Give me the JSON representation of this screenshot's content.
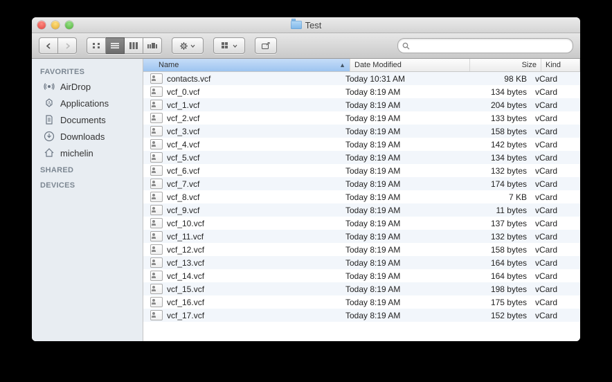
{
  "window": {
    "title": "Test"
  },
  "toolbar": {
    "search_placeholder": ""
  },
  "sidebar": {
    "sections": [
      {
        "title": "FAVORITES",
        "items": [
          {
            "id": "airdrop",
            "label": "AirDrop",
            "icon": "airdrop-icon"
          },
          {
            "id": "applications",
            "label": "Applications",
            "icon": "applications-icon"
          },
          {
            "id": "documents",
            "label": "Documents",
            "icon": "documents-icon"
          },
          {
            "id": "downloads",
            "label": "Downloads",
            "icon": "downloads-icon"
          },
          {
            "id": "michelin",
            "label": "michelin",
            "icon": "home-icon"
          }
        ]
      },
      {
        "title": "SHARED",
        "items": []
      },
      {
        "title": "DEVICES",
        "items": []
      }
    ]
  },
  "columns": {
    "name": "Name",
    "date": "Date Modified",
    "size": "Size",
    "kind": "Kind",
    "sort_column": "name",
    "sort_dir": "asc"
  },
  "files": [
    {
      "name": "contacts.vcf",
      "date": "Today 10:31 AM",
      "size": "98 KB",
      "kind": "vCard"
    },
    {
      "name": "vcf_0.vcf",
      "date": "Today 8:19 AM",
      "size": "134 bytes",
      "kind": "vCard"
    },
    {
      "name": "vcf_1.vcf",
      "date": "Today 8:19 AM",
      "size": "204 bytes",
      "kind": "vCard"
    },
    {
      "name": "vcf_2.vcf",
      "date": "Today 8:19 AM",
      "size": "133 bytes",
      "kind": "vCard"
    },
    {
      "name": "vcf_3.vcf",
      "date": "Today 8:19 AM",
      "size": "158 bytes",
      "kind": "vCard"
    },
    {
      "name": "vcf_4.vcf",
      "date": "Today 8:19 AM",
      "size": "142 bytes",
      "kind": "vCard"
    },
    {
      "name": "vcf_5.vcf",
      "date": "Today 8:19 AM",
      "size": "134 bytes",
      "kind": "vCard"
    },
    {
      "name": "vcf_6.vcf",
      "date": "Today 8:19 AM",
      "size": "132 bytes",
      "kind": "vCard"
    },
    {
      "name": "vcf_7.vcf",
      "date": "Today 8:19 AM",
      "size": "174 bytes",
      "kind": "vCard"
    },
    {
      "name": "vcf_8.vcf",
      "date": "Today 8:19 AM",
      "size": "7 KB",
      "kind": "vCard"
    },
    {
      "name": "vcf_9.vcf",
      "date": "Today 8:19 AM",
      "size": "11 bytes",
      "kind": "vCard"
    },
    {
      "name": "vcf_10.vcf",
      "date": "Today 8:19 AM",
      "size": "137 bytes",
      "kind": "vCard"
    },
    {
      "name": "vcf_11.vcf",
      "date": "Today 8:19 AM",
      "size": "132 bytes",
      "kind": "vCard"
    },
    {
      "name": "vcf_12.vcf",
      "date": "Today 8:19 AM",
      "size": "158 bytes",
      "kind": "vCard"
    },
    {
      "name": "vcf_13.vcf",
      "date": "Today 8:19 AM",
      "size": "164 bytes",
      "kind": "vCard"
    },
    {
      "name": "vcf_14.vcf",
      "date": "Today 8:19 AM",
      "size": "164 bytes",
      "kind": "vCard"
    },
    {
      "name": "vcf_15.vcf",
      "date": "Today 8:19 AM",
      "size": "198 bytes",
      "kind": "vCard"
    },
    {
      "name": "vcf_16.vcf",
      "date": "Today 8:19 AM",
      "size": "175 bytes",
      "kind": "vCard"
    },
    {
      "name": "vcf_17.vcf",
      "date": "Today 8:19 AM",
      "size": "152 bytes",
      "kind": "vCard"
    }
  ]
}
